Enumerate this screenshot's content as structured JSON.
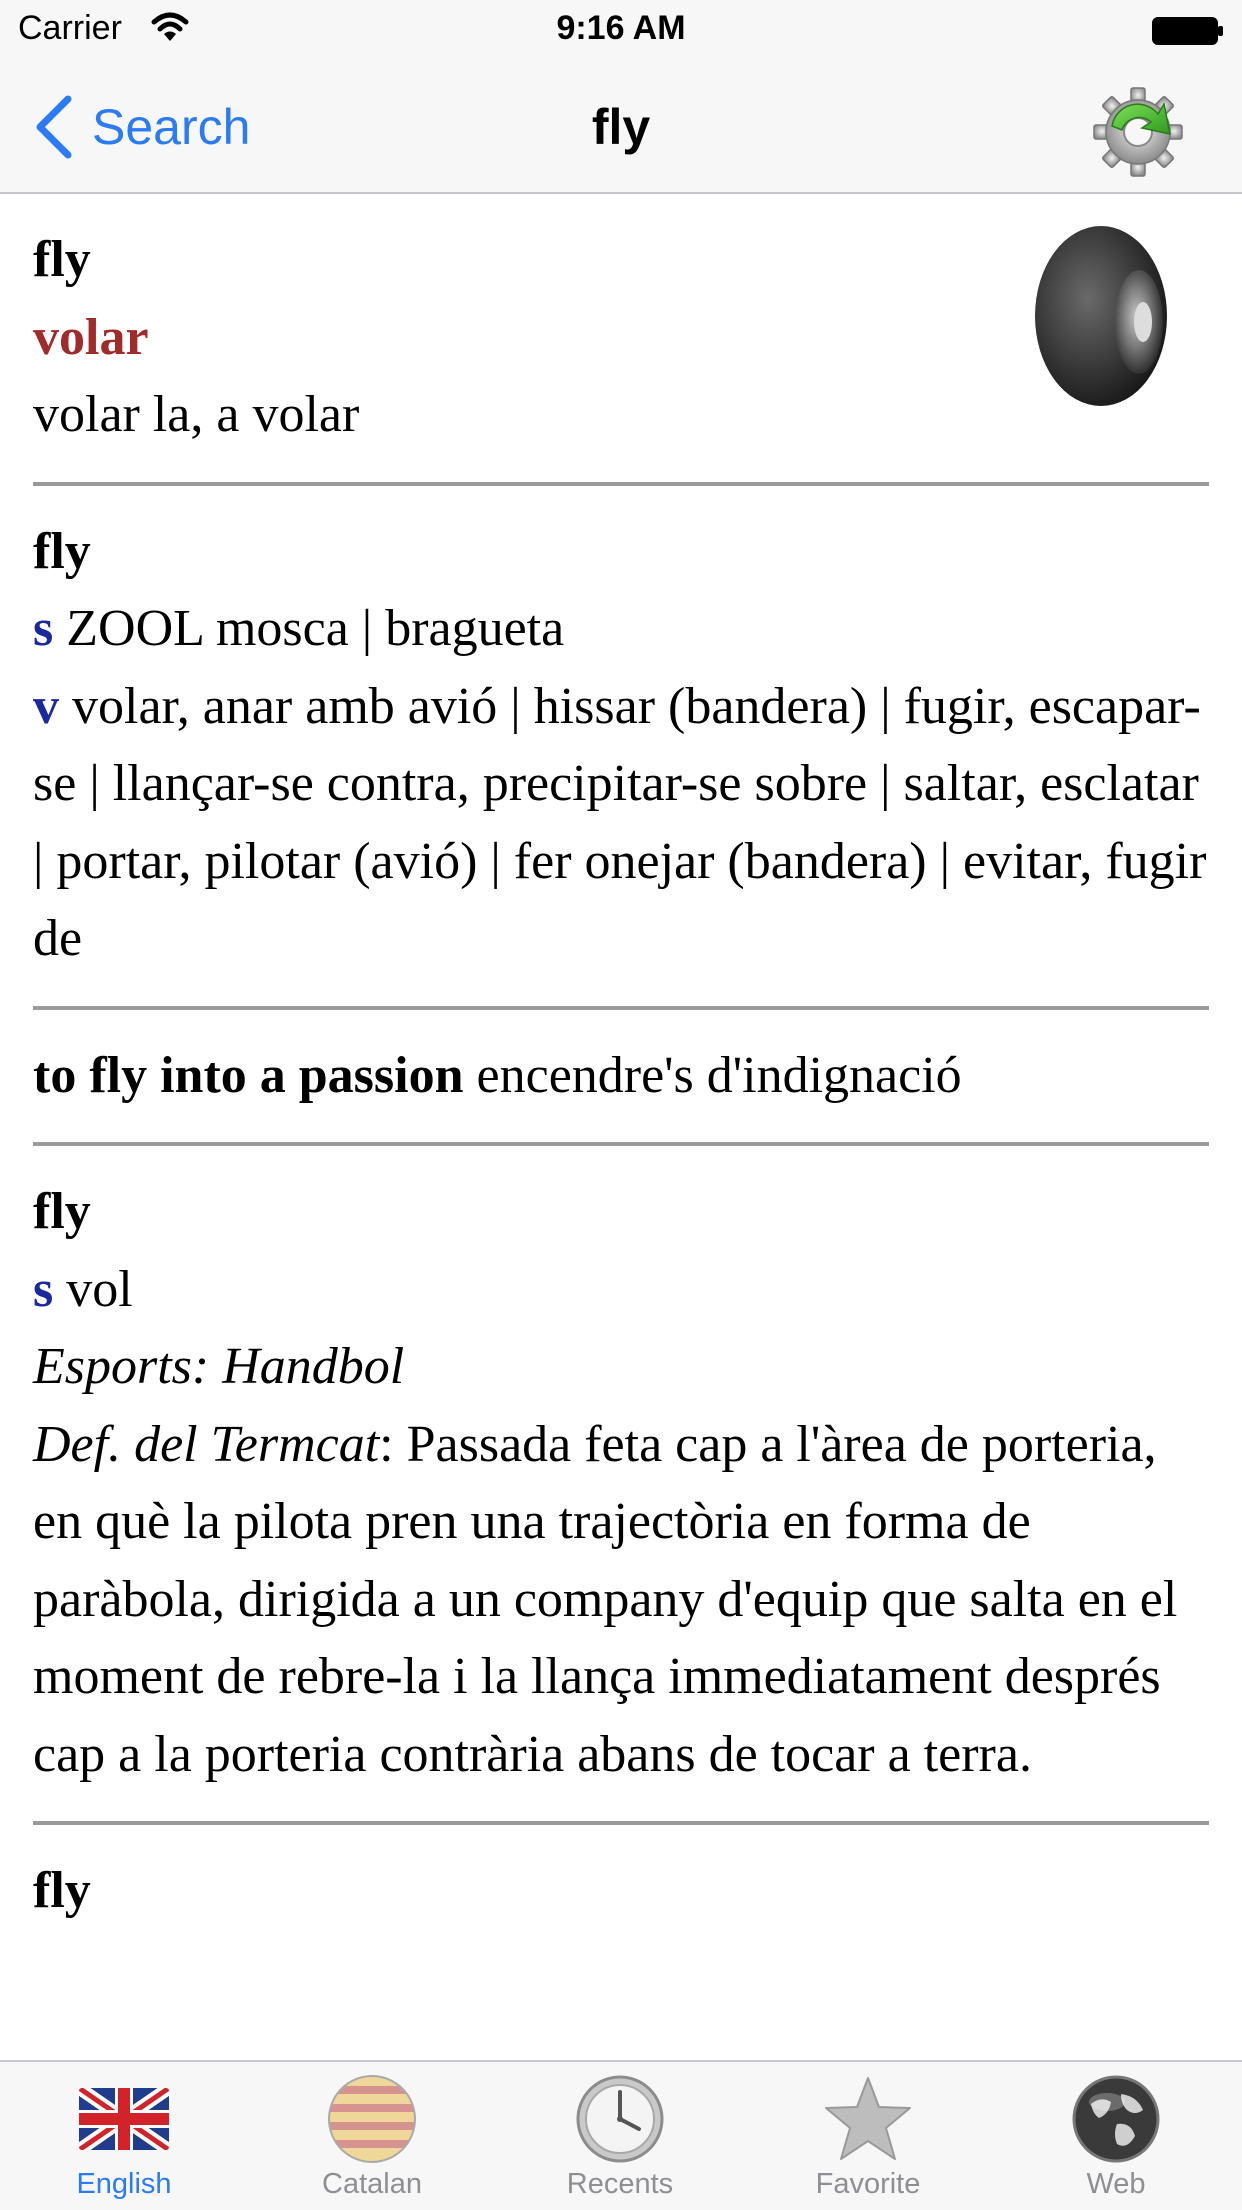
{
  "status_bar": {
    "carrier": "Carrier",
    "time": "9:16 AM"
  },
  "nav": {
    "back_label": "Search",
    "title": "fly"
  },
  "entries": [
    {
      "headword": "fly",
      "translation": "volar",
      "note": "volar la, a volar"
    },
    {
      "headword": "fly",
      "senses": [
        {
          "pos": "s",
          "text": " ZOOL mosca | bragueta"
        },
        {
          "pos": "v",
          "text": " volar, anar amb avió | hissar (bandera) | fugir, escapar-se | llançar-se contra, precipitar-se sobre | saltar, esclatar | portar, pilotar (avió) | fer onejar (bandera) | evitar, fugir de"
        }
      ]
    },
    {
      "phrase": "to fly into a passion",
      "meaning": " encendre's d'indignació"
    },
    {
      "headword": "fly",
      "pos": "s",
      "text": " vol",
      "domain": "Esports: Handbol",
      "def_label": "Def. del Termcat",
      "def_text": ": Passada feta cap a l'àrea de porteria, en què la pilota pren una trajectòria en forma de paràbola, dirigida a un company d'equip que salta en el moment de rebre-la i la llança immediatament després cap a la porteria contrària abans de tocar a terra."
    },
    {
      "headword": "fly"
    }
  ],
  "tabs": [
    {
      "label": "English",
      "icon": "uk-flag-icon",
      "active": true
    },
    {
      "label": "Catalan",
      "icon": "catalan-flag-icon",
      "active": false
    },
    {
      "label": "Recents",
      "icon": "clock-icon",
      "active": false
    },
    {
      "label": "Favorite",
      "icon": "star-icon",
      "active": false
    },
    {
      "label": "Web",
      "icon": "globe-icon",
      "active": false
    }
  ],
  "colors": {
    "accent": "#2a7bf4",
    "translation": "#a12a2a",
    "part_of_speech": "#1a2a9e",
    "inactive_tab": "#8e8e93"
  }
}
